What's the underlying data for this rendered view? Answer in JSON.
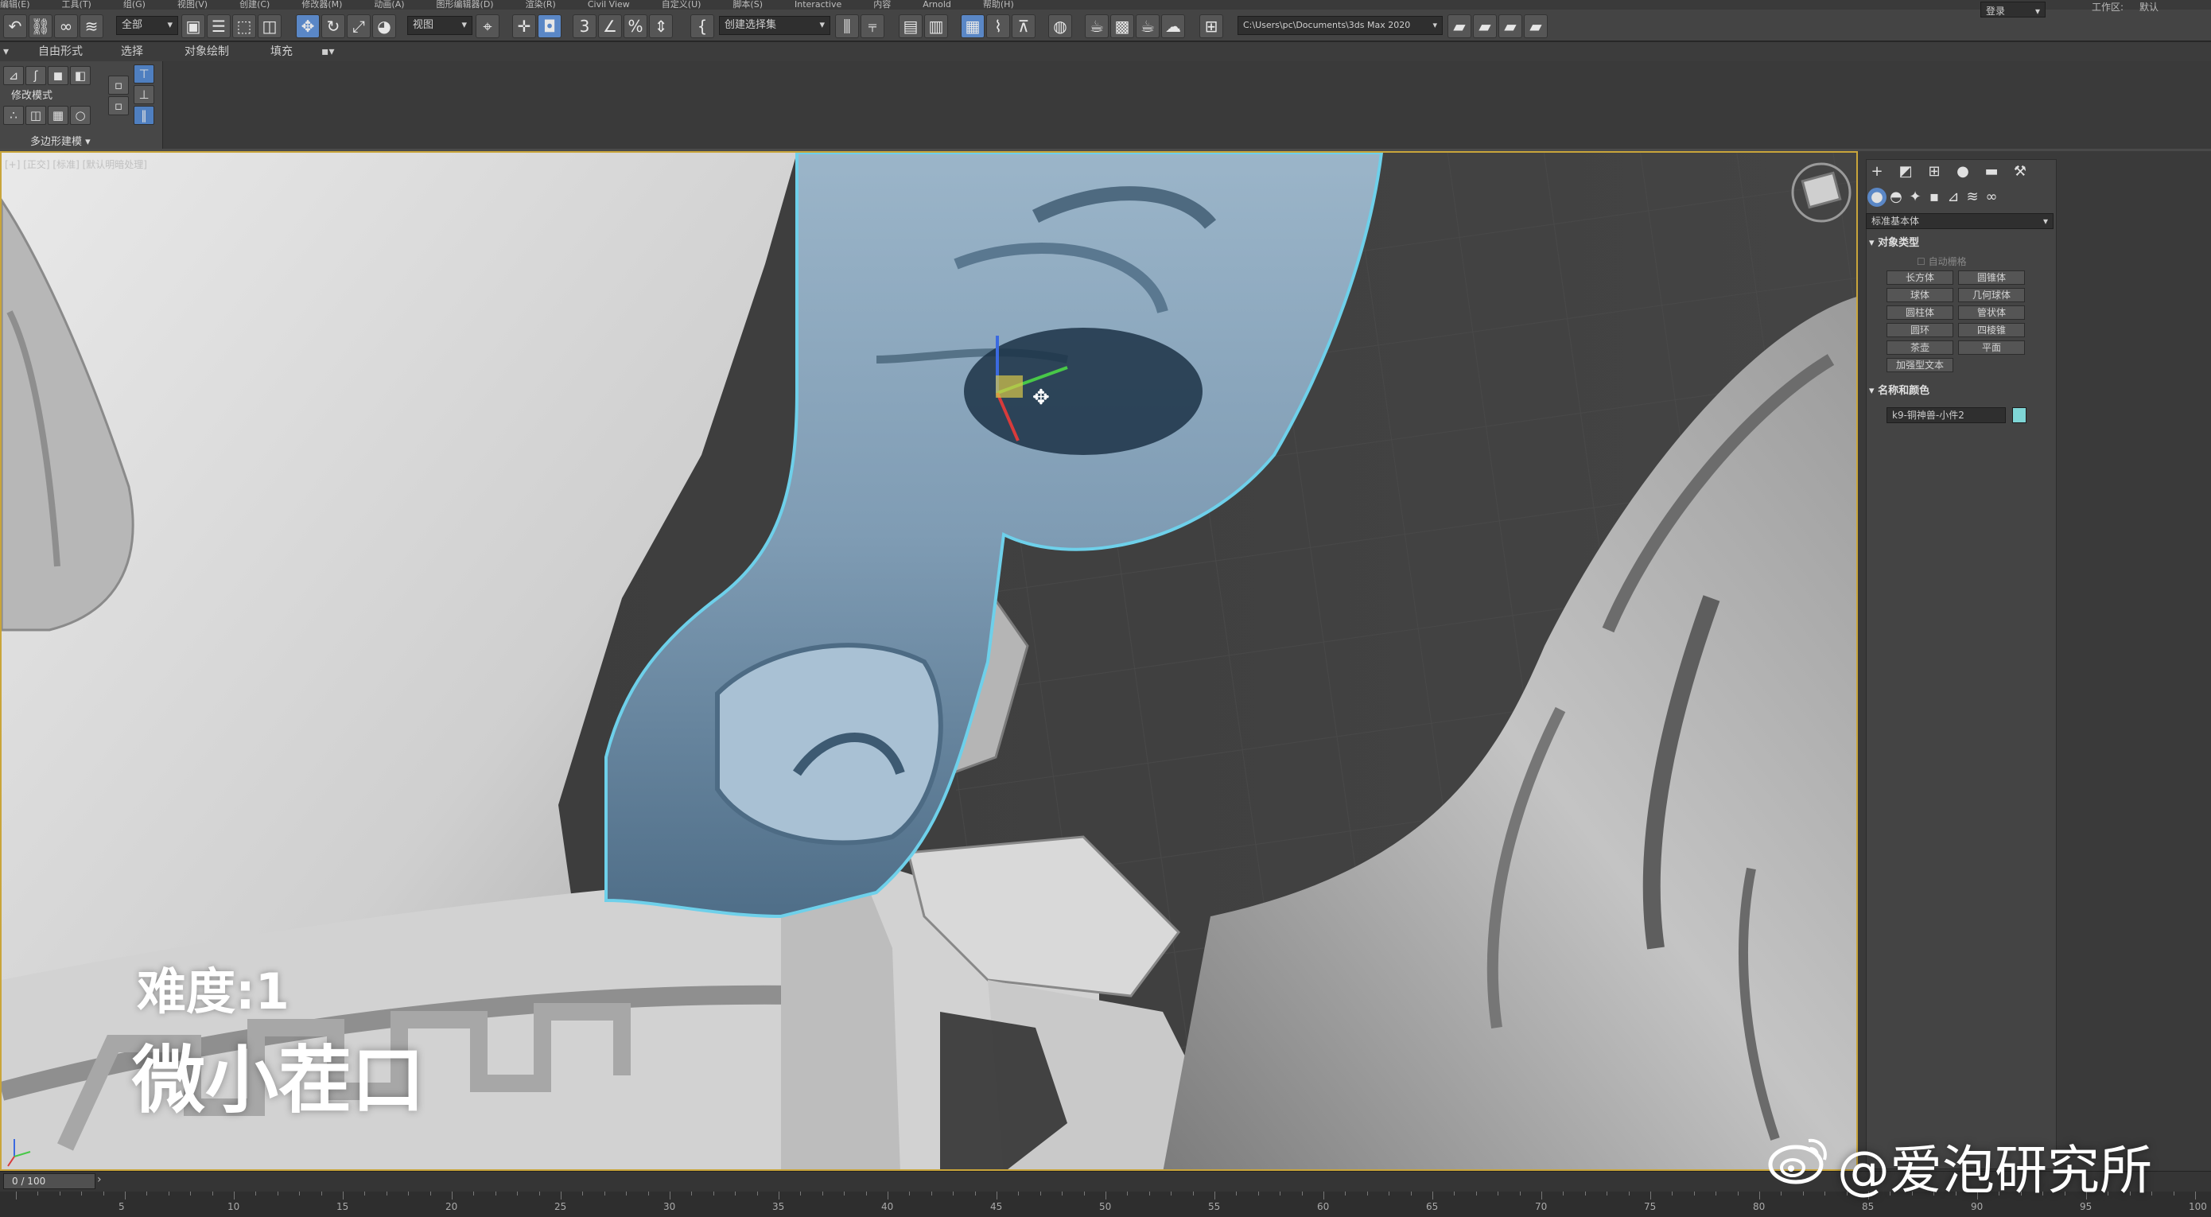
{
  "menubar": {
    "items": [
      "编辑(E)",
      "工具(T)",
      "组(G)",
      "视图(V)",
      "创建(C)",
      "修改器(M)",
      "动画(A)",
      "图形编辑器(D)",
      "渲染(R)",
      "Civil View",
      "自定义(U)",
      "脚本(S)",
      "Interactive",
      "内容",
      "Arnold",
      "帮助(H)"
    ],
    "login": "登录",
    "workspace_label": "工作区:",
    "workspace_value": "默认"
  },
  "toolbar": {
    "selection_filter": "全部",
    "reference_coord": "视图",
    "named_selection": "创建选择集",
    "project_path": "C:\\Users\\pc\\Documents\\3ds Max 2020"
  },
  "ribbon": {
    "tabs": [
      "自由形式",
      "选择",
      "对象绘制",
      "填充"
    ],
    "panel_title": "修改模式",
    "panel_footer": "多边形建模"
  },
  "viewport": {
    "label": "[+] [正交] [标准] [默认明暗处理]",
    "difficulty": "难度:1",
    "caption": "微小茬口"
  },
  "command_panel": {
    "dropdown": "标准基本体",
    "rollout_object_type": "对象类型",
    "autogrid": "自动栅格",
    "buttons": [
      "长方体",
      "圆锥体",
      "球体",
      "几何球体",
      "圆柱体",
      "管状体",
      "圆环",
      "四棱锥",
      "茶壶",
      "平面",
      "加强型文本"
    ],
    "rollout_name_color": "名称和颜色",
    "object_name": "k9-铜神兽-小件2",
    "object_color": "#7fd6d6"
  },
  "timeline": {
    "frame": "0 / 100",
    "ticks": [
      "5",
      "10",
      "15",
      "20",
      "25",
      "30",
      "35",
      "40",
      "45",
      "50",
      "55",
      "60",
      "65",
      "70",
      "75",
      "80",
      "85",
      "90",
      "95",
      "100"
    ]
  },
  "watermark": "@爱泡研究所"
}
